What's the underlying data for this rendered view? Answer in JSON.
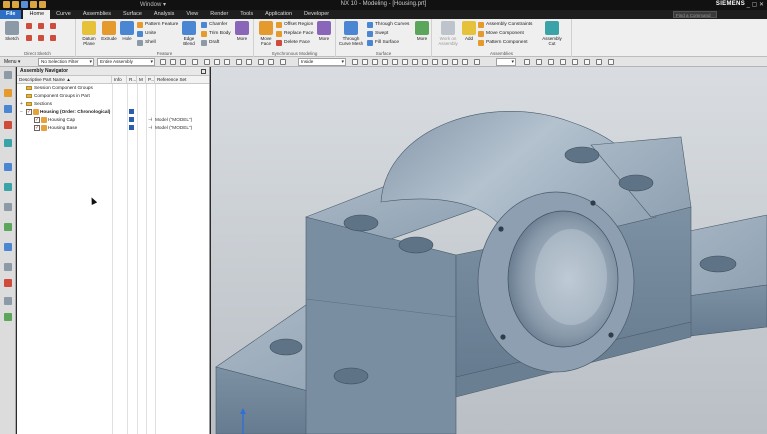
{
  "titlebar": {
    "window_menu": "Window ▾",
    "title": "NX 10 - Modeling - [Housing.prt]",
    "brand": "SIEMENS",
    "controls": "_ ▢ ✕"
  },
  "tabs": [
    "File",
    "Home",
    "Curve",
    "Assemblies",
    "Surface",
    "Analysis",
    "View",
    "Render",
    "Tools",
    "Application",
    "Developer"
  ],
  "active_tab": "Home",
  "command_finder": {
    "placeholder": "Find a Command"
  },
  "ribbon": {
    "groups": {
      "direct_sketch": "Direct Sketch",
      "feature": "Feature",
      "synchronous": "Synchronous Modeling",
      "surface": "Surface",
      "assemblies": "Assemblies"
    },
    "buttons": {
      "sketch": "Sketch",
      "datum_plane": "Datum Plane",
      "extrude": "Extrude",
      "hole": "Hole",
      "pattern_feature": "Pattern Feature",
      "unite": "Unite",
      "shell": "Shell",
      "edge_blend": "Edge Blend",
      "chamfer": "Chamfer",
      "trim_body": "Trim Body",
      "draft": "Draft",
      "more1": "More",
      "move_face": "Move Face",
      "offset_region": "Offset Region",
      "replace_face": "Replace Face",
      "delete_face": "Delete Face",
      "more2": "More",
      "through_curve_mesh": "Through Curve Mesh",
      "through_curves": "Through Curves",
      "swept": "Swept",
      "fill_surface": "Fill Surface",
      "more3": "More",
      "work_on_assembly": "Work on Assembly",
      "add": "Add",
      "assembly_constraints": "Assembly Constraints",
      "move_component": "Move Component",
      "pattern_component": "Pattern Component",
      "assembly_cut": "Assembly Cut"
    }
  },
  "toolbar2": {
    "menu": "Menu ▾",
    "selection_filter": "No Selection Filter",
    "scope": "Entire Assembly",
    "inside": "Inside"
  },
  "navigator": {
    "title": "Assembly Navigator",
    "columns": {
      "name": "Descriptive Part Name ▲",
      "info": "Info",
      "r": "R...",
      "m": "M",
      "p": "P...",
      "ref": "Reference Set"
    },
    "rows": [
      {
        "label": "Session Component Groups",
        "ref": ""
      },
      {
        "label": "Component Groups in Part",
        "ref": ""
      },
      {
        "label": "Sections",
        "ref": ""
      },
      {
        "label": "Housing (Order: Chronological)",
        "ref": ""
      },
      {
        "label": "Housing Cap",
        "ref": "Model (\"MODEL\")"
      },
      {
        "label": "Housing Base",
        "ref": "Model (\"MODEL\")"
      }
    ]
  }
}
